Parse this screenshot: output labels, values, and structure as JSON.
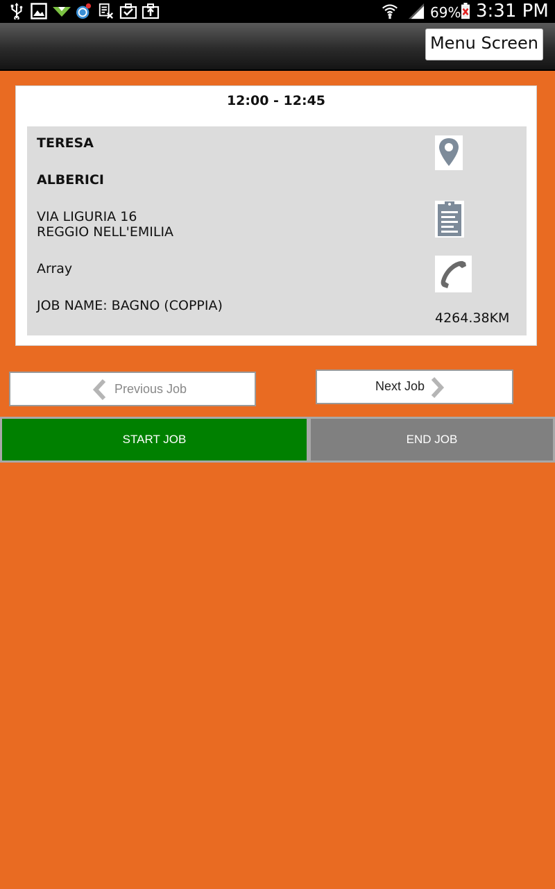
{
  "status_bar": {
    "icons": [
      "usb-icon",
      "image-icon",
      "download-icon",
      "globe-notification-icon",
      "calendar-x-icon",
      "briefcase-check-icon",
      "briefcase-upload-icon",
      "wifi-icon",
      "signal-icon",
      "battery-icon"
    ],
    "battery_percent": "69%",
    "time": "3:31 PM"
  },
  "action_bar": {
    "menu_button_label": "Menu Screen"
  },
  "job_card": {
    "time_range": "12:00 - 12:45",
    "first_name": "TERESA",
    "last_name": "ALBERICI",
    "address_line1": "VIA LIGURIA 16",
    "address_line2": "REGGIO NELL'EMILIA",
    "array_text": "Array",
    "job_name": "JOB NAME: BAGNO (COPPIA)",
    "distance": "4264.38KM",
    "icons": [
      "map-pin-icon",
      "clipboard-icon",
      "phone-icon"
    ]
  },
  "navigation": {
    "previous_label": "Previous Job",
    "next_label": "Next Job"
  },
  "actions": {
    "start_label": "START JOB",
    "end_label": "END JOB"
  },
  "colors": {
    "background": "#e96b22",
    "start": "#008000",
    "end": "#808080",
    "icon_grey": "#7d8b9a"
  }
}
